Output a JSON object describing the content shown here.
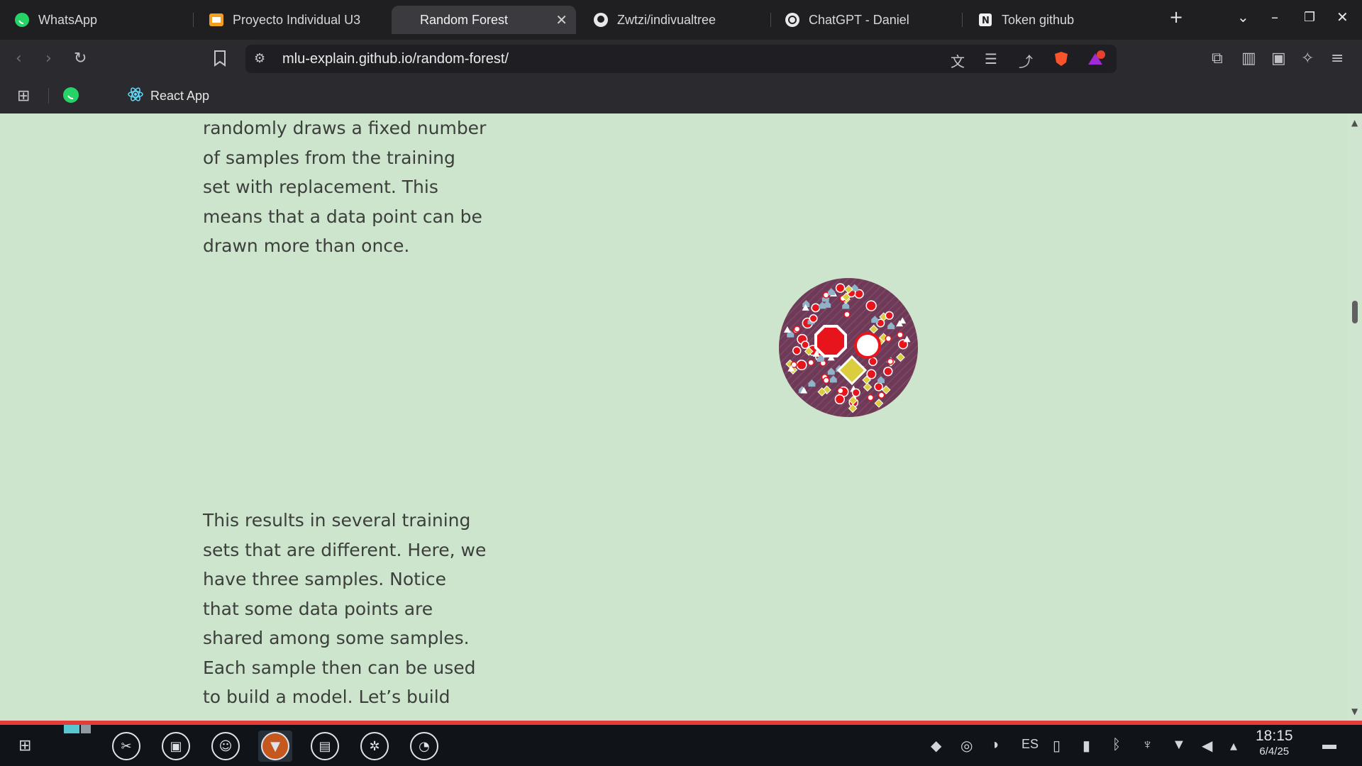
{
  "tabs": [
    {
      "label": "WhatsApp",
      "icon": "whatsapp-icon"
    },
    {
      "label": "Proyecto Individual U3",
      "icon": "slides-icon"
    },
    {
      "label": "Random Forest",
      "icon": "none",
      "active": true
    },
    {
      "label": "Zwtzi/indivualtree",
      "icon": "github-icon"
    },
    {
      "label": "ChatGPT - Daniel",
      "icon": "chatgpt-icon"
    },
    {
      "label": "Token github",
      "icon": "notion-icon"
    }
  ],
  "address_bar": {
    "url": "mlu-explain.github.io/random-forest/"
  },
  "bookmarks": [
    {
      "label": "React App",
      "icon": "react-icon"
    }
  ],
  "content": {
    "paragraph_1": "randomly draws a fixed number of samples from the training set with replacement. This means that a data point can be drawn more than once.",
    "paragraph_2": "This results in several training sets that are different. Here, we have three samples. Notice that some data points are shared among some samples. Each sample then can be used to build a model. Let’s build"
  },
  "taskbar": {
    "language": "ES",
    "time": "18:15",
    "date": "6/4/25"
  },
  "colors": {
    "page_background": "#cce5cc",
    "text": "#3c3f3c",
    "accent_red": "#e8141c",
    "accent_yellow": "#dccd3e",
    "circle_background": "#6e3a57"
  }
}
